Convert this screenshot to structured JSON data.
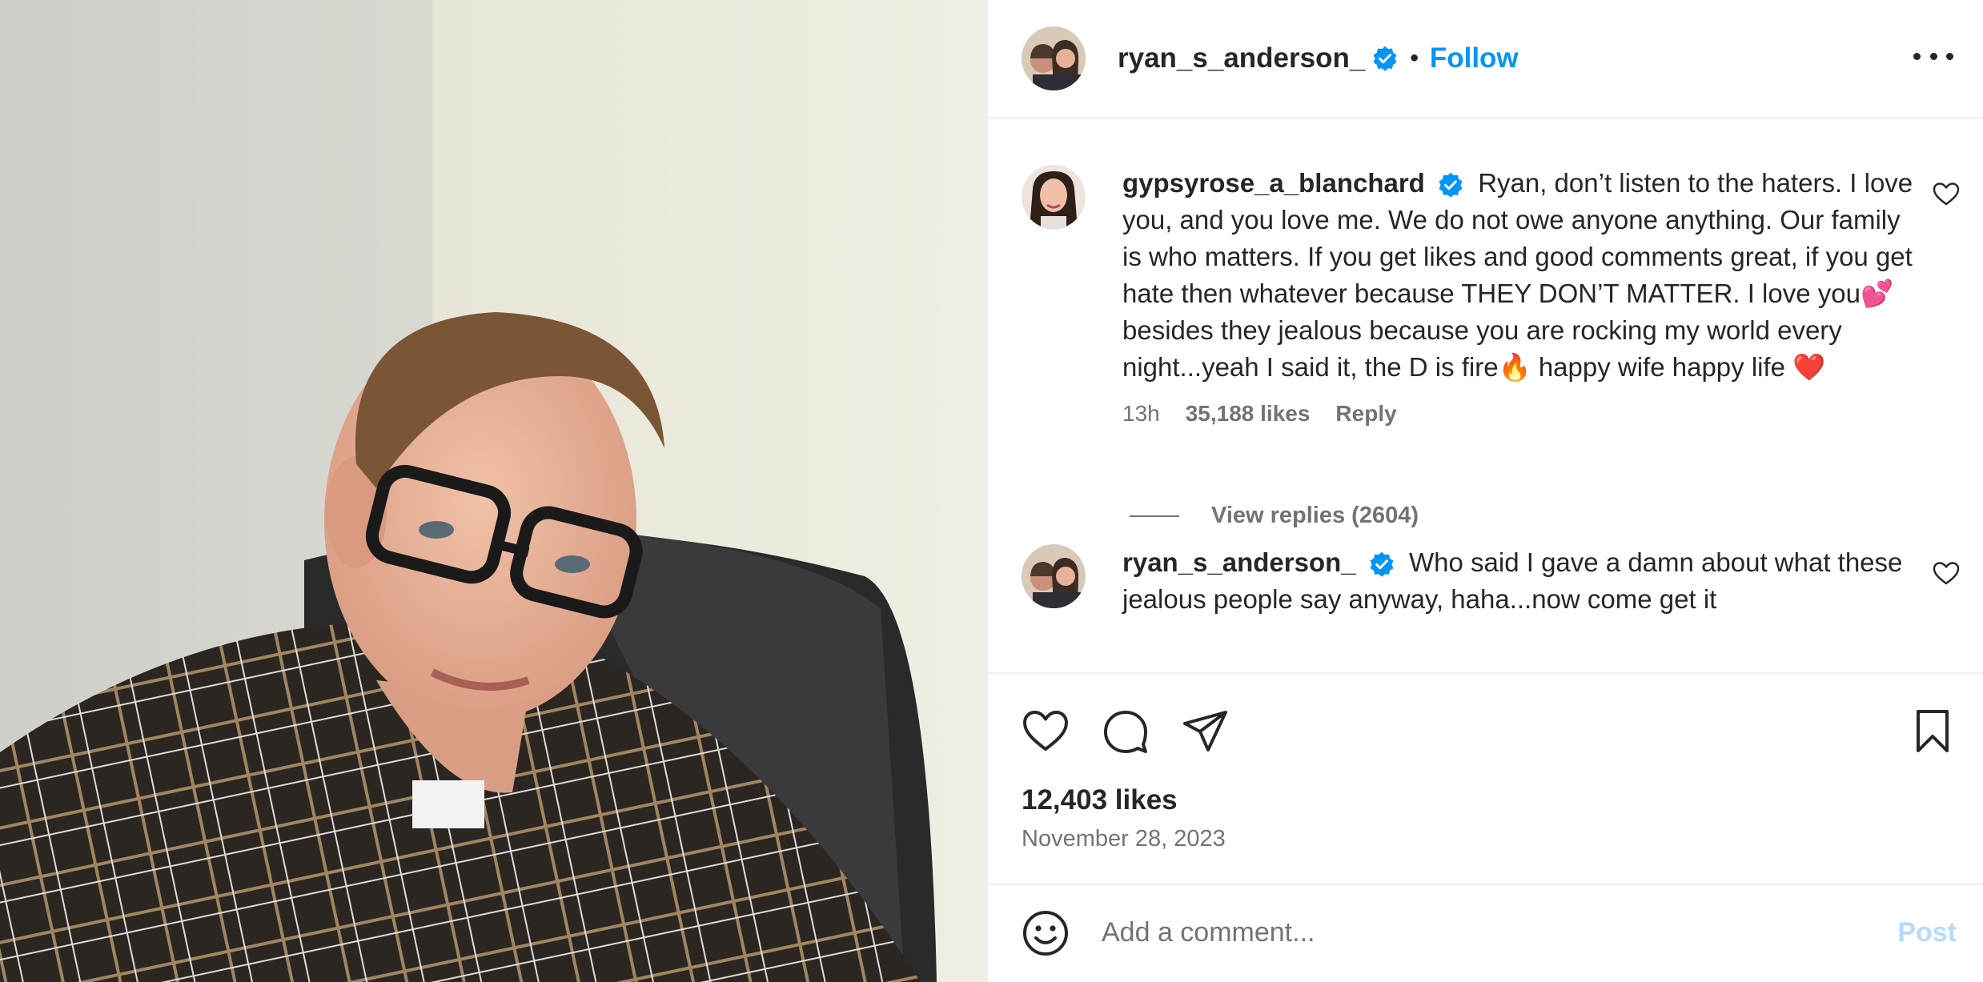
{
  "photo": {
    "icon": "selfie-photo"
  },
  "header": {
    "username": "ryan_s_anderson_",
    "separator": "•",
    "follow_label": "Follow",
    "more_icon": "more-horizontal-icon"
  },
  "comments": [
    {
      "username": "gypsyrose_a_blanchard",
      "text": "Ryan, don’t listen to the haters. I love you, and you love me. We do not owe anyone anything. Our family is who matters. If you get likes and good comments great, if you get hate then whatever because THEY DON’T MATTER. I love you💕 besides they jealous because you are rocking my world every night...yeah I said it, the D is fire🔥 happy wife happy life ❤️",
      "time": "13h",
      "likes": "35,188 likes",
      "reply_label": "Reply",
      "view_replies": "View replies (2604)"
    },
    {
      "username": "ryan_s_anderson_",
      "text": "Who said I gave a damn about what these jealous people say anyway, haha...now come get it"
    }
  ],
  "post": {
    "likes": "12,403 likes",
    "date": "November 28, 2023"
  },
  "add_comment": {
    "placeholder": "Add a comment...",
    "post_label": "Post"
  },
  "colors": {
    "accent": "#0095f6",
    "verified": "#0095f6",
    "text": "#262626",
    "secondary": "#737373",
    "post_disabled": "#b3dbff"
  }
}
